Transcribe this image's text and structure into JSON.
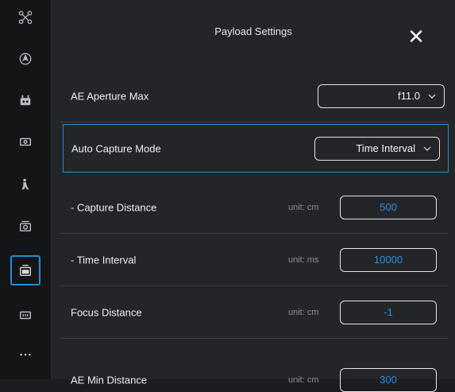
{
  "panel": {
    "title": "Payload Settings"
  },
  "rows": {
    "ae_aperture": {
      "label": "AE Aperture Max",
      "value": "f11.0"
    },
    "auto_capture": {
      "label": "Auto Capture Mode",
      "value": "Time Interval"
    },
    "capture_distance": {
      "label": "- Capture Distance",
      "unit": "unit: cm",
      "value": "500"
    },
    "time_interval": {
      "label": "- Time Interval",
      "unit": "unit: ms",
      "value": "10000"
    },
    "focus_distance": {
      "label": "Focus Distance",
      "unit": "unit: cm",
      "value": "-1"
    },
    "ae_min_distance": {
      "label": "AE Min Distance",
      "unit": "unit: cm",
      "value": "300"
    }
  },
  "colors": {
    "accent": "#1e8fd6",
    "value_text": "#2e8fe0",
    "panel_bg": "#232528",
    "rail_bg": "#141517"
  },
  "rail_icons": [
    "drone-icon",
    "compass-icon",
    "robot-icon",
    "camera-box-icon",
    "person-icon",
    "camera-icon",
    "payload-icon",
    "tv-icon",
    "more-icon"
  ]
}
